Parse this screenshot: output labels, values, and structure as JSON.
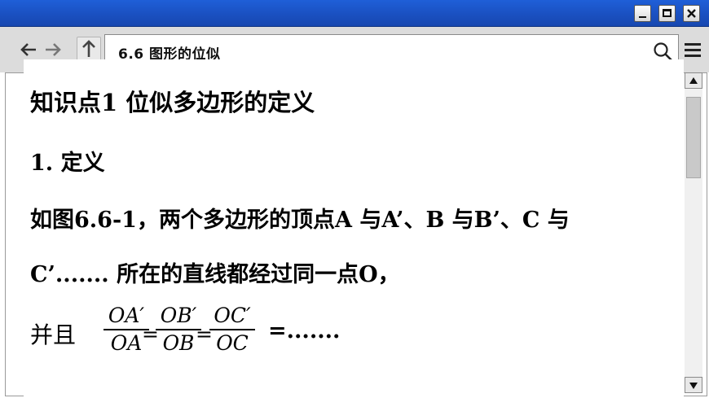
{
  "window": {
    "title": "",
    "buttons": {
      "minimize": "minimize",
      "maximize": "maximize",
      "close": "close"
    }
  },
  "toolbar": {
    "back_icon": "arrow-left-icon",
    "forward_icon": "arrow-right-icon",
    "up_icon": "arrow-up-icon",
    "address": "6.6 图形的位似",
    "search_icon": "search-icon",
    "menu_icon": "hamburger-menu-icon"
  },
  "document": {
    "heading": "知识点1  位似多边形的定义",
    "subheading": "1. 定义",
    "paragraph1": "如图6.6-1，两个多边形的顶点A 与A’、B 与B’、C 与",
    "paragraph2": "C’....... 所在的直线都经过同一点O，",
    "formula": {
      "prefix": "并且",
      "fractions": [
        {
          "numerator": "OA′",
          "denominator": "OA"
        },
        {
          "numerator": "OB′",
          "denominator": "OB"
        },
        {
          "numerator": "OC′",
          "denominator": "OC"
        }
      ],
      "equals": "=",
      "suffix": "=......."
    }
  },
  "colors": {
    "titlebar": "#1a4fbf",
    "toolbar": "#dcdcdc",
    "text": "#000000"
  }
}
